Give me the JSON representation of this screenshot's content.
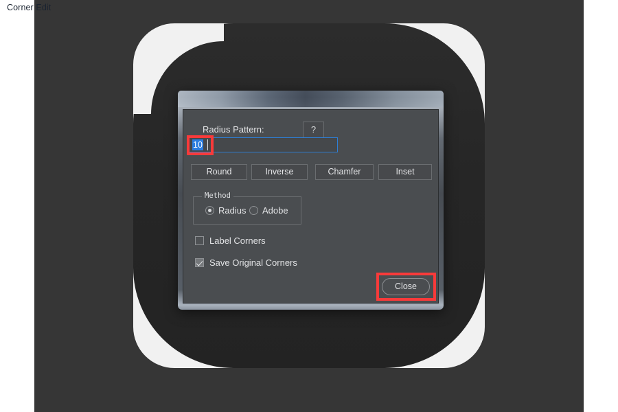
{
  "window": {
    "title": "Corner Edit"
  },
  "form": {
    "radius_label": "Radius Pattern:",
    "help_button": "?",
    "pattern_value": "10",
    "pattern_placeholder": ""
  },
  "actions": [
    {
      "label": "Round"
    },
    {
      "label": "Inverse"
    },
    {
      "label": "Chamfer"
    },
    {
      "label": "Inset"
    }
  ],
  "method": {
    "legend": "Method",
    "options": [
      {
        "label": "Radius",
        "selected": true
      },
      {
        "label": "Adobe",
        "selected": false
      }
    ]
  },
  "checkboxes": [
    {
      "label": "Label Corners",
      "checked": false
    },
    {
      "label": "Save Original Corners",
      "checked": true
    }
  ],
  "footer": {
    "close_label": "Close"
  },
  "colors": {
    "canvas_background": "#363636",
    "page_background": "#ffffff",
    "artwork_dark": "#272727",
    "artwork_light": "#f1f1f1",
    "dialog_panel": "#4a4d50",
    "accent_focus": "#2d7fd6",
    "selection": "#2b7de0",
    "highlight": "#f93a3a"
  }
}
